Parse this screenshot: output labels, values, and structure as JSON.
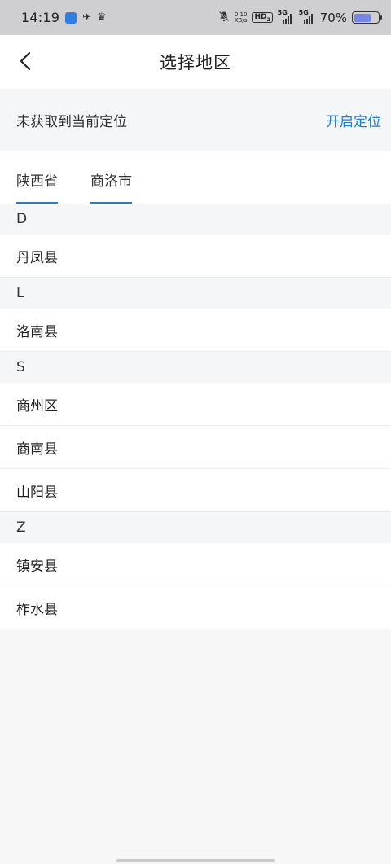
{
  "status_bar": {
    "time": "14:19",
    "net_speed_value": "0.10",
    "net_speed_unit": "KB/s",
    "hd": "HD",
    "hd_sub": "2",
    "signal1": "5G",
    "signal2": "5G",
    "battery_pct": "70%",
    "battery_level": 0.7,
    "battery_color": "#7486e8"
  },
  "nav": {
    "title": "选择地区"
  },
  "location": {
    "status": "未获取到当前定位",
    "action": "开启定位",
    "action_color": "#1f7fd8"
  },
  "tabs": [
    {
      "label": "陕西省"
    },
    {
      "label": "商洛市"
    }
  ],
  "groups": [
    {
      "letter": "D",
      "items": [
        "丹凤县"
      ]
    },
    {
      "letter": "L",
      "items": [
        "洛南县"
      ]
    },
    {
      "letter": "S",
      "items": [
        "商州区",
        "商南县",
        "山阳县"
      ]
    },
    {
      "letter": "Z",
      "items": [
        "镇安县",
        "柞水县"
      ]
    }
  ]
}
